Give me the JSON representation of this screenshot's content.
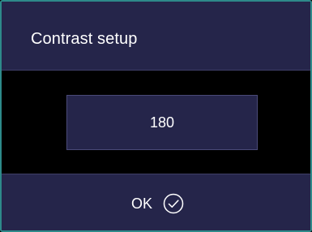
{
  "dialog": {
    "title": "Contrast setup",
    "value": "180",
    "ok_label": "OK",
    "ok_icon": "check-circle-icon"
  },
  "colors": {
    "panel": "#25254a",
    "background": "#000000",
    "border": "#2e8a8a",
    "text": "#ffffff"
  }
}
